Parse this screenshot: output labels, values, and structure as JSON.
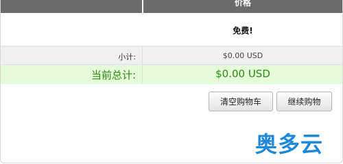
{
  "cart": {
    "header": {
      "price_label": "价格"
    },
    "item": {
      "price": "免费!"
    },
    "subtotal": {
      "label": "小计:",
      "value": "$0.00 USD"
    },
    "total": {
      "label": "当前总计:",
      "value": "$0.00 USD"
    },
    "buttons": {
      "clear_cart": "清空购物车",
      "continue_shopping": "继续购物"
    }
  },
  "watermark": {
    "text": "奥多云"
  },
  "colors": {
    "header_bg": "#6b6b6b",
    "total_bg": "#e6fbd9",
    "total_text": "#2a8a0e",
    "logo": "#1d89d8"
  }
}
